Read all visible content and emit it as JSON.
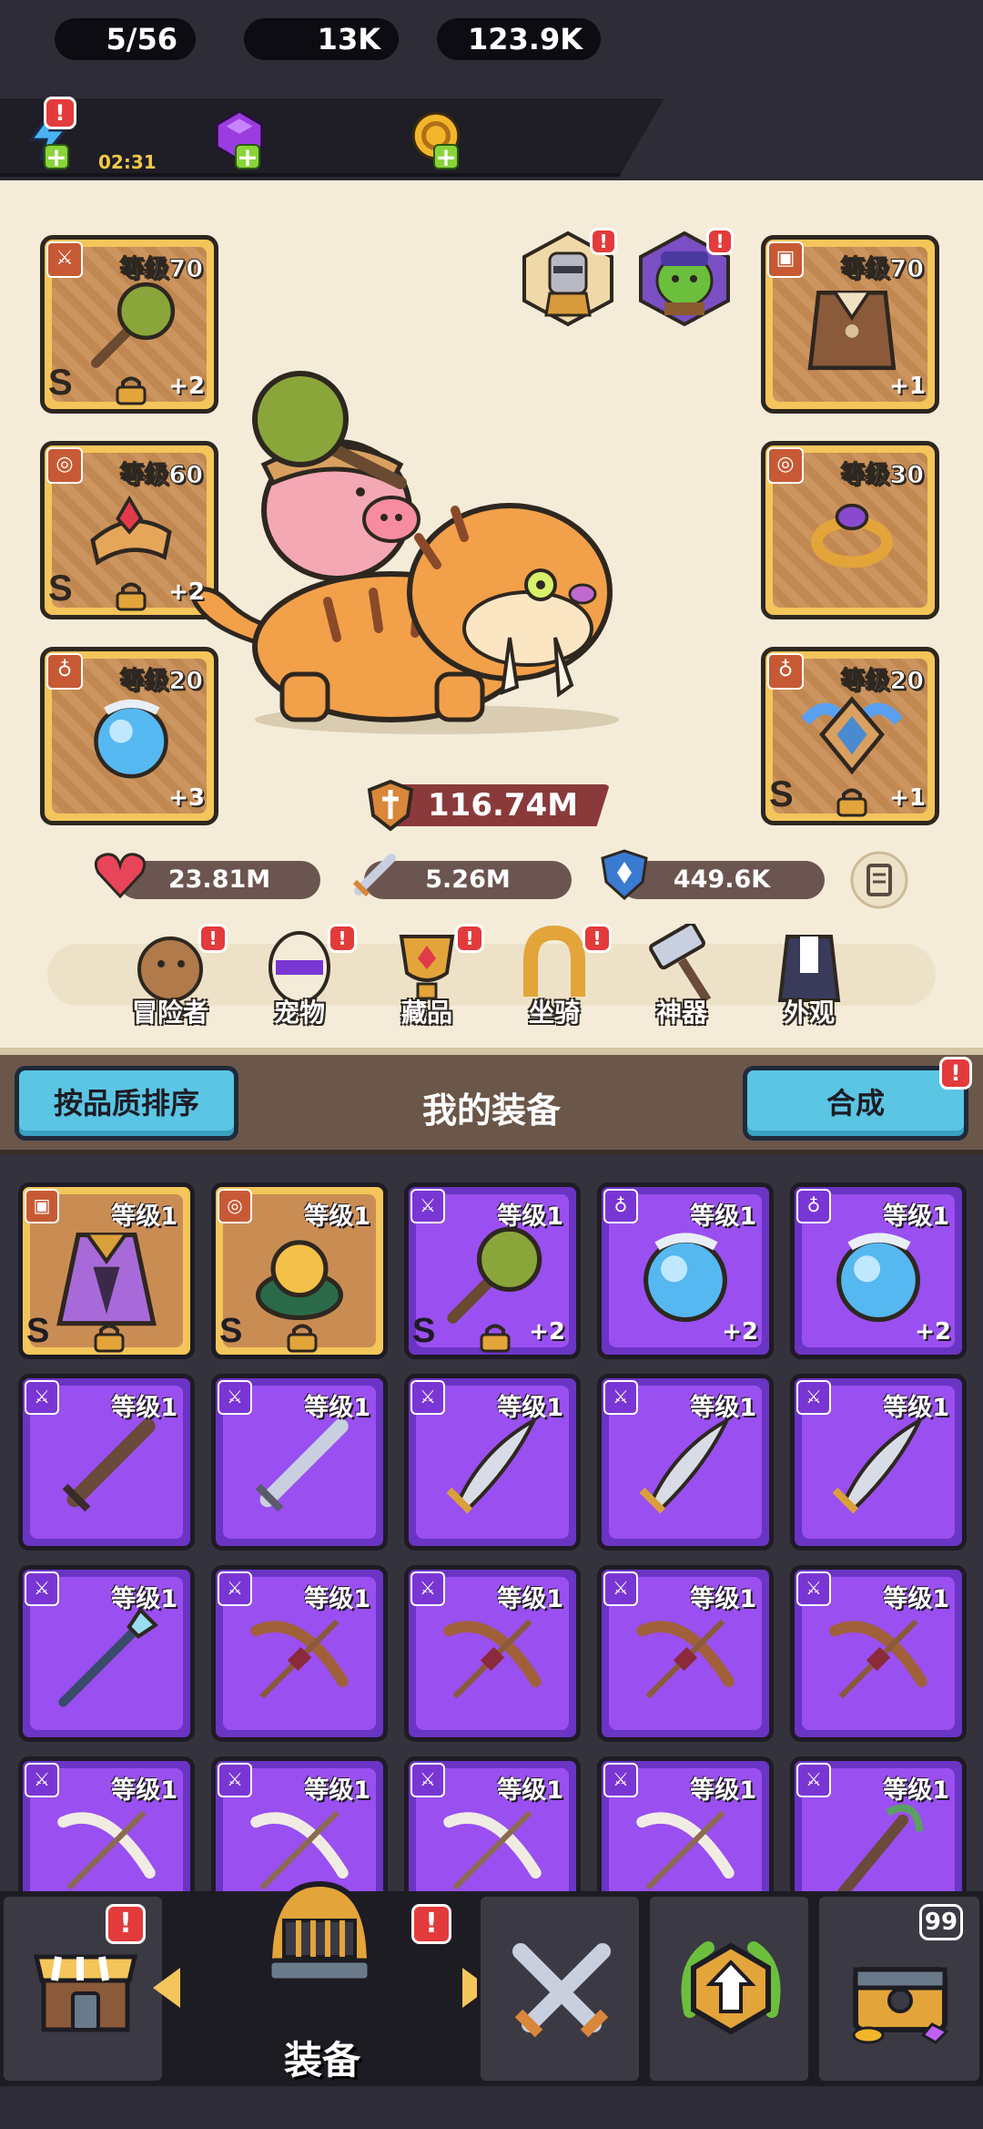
{
  "resources": {
    "energy": "5/56",
    "energy_timer": "02:31",
    "gems": "13K",
    "gold": "123.9K",
    "energy_alert": "!"
  },
  "hero": {
    "slots_left": [
      {
        "level": "等级70",
        "grade": "S",
        "plus": "+2",
        "type_icon": "sword-icon",
        "art": "mace"
      },
      {
        "level": "等级60",
        "grade": "S",
        "plus": "+2",
        "type_icon": "ring-icon",
        "art": "bracer"
      },
      {
        "level": "等级20",
        "grade": "",
        "plus": "+3",
        "type_icon": "necklace-icon",
        "art": "orb"
      }
    ],
    "slots_right": [
      {
        "level": "等级70",
        "grade": "",
        "plus": "+1",
        "type_icon": "armor-icon",
        "art": "armor"
      },
      {
        "level": "等级30",
        "grade": "",
        "plus": "",
        "type_icon": "ring-icon",
        "art": "ring"
      },
      {
        "level": "等级20",
        "grade": "S",
        "plus": "+1",
        "type_icon": "necklace-icon",
        "art": "amulet"
      }
    ],
    "power": "116.74M",
    "stats": {
      "hp": "23.81M",
      "attack": "5.26M",
      "defense": "449.6K"
    },
    "alert": "!"
  },
  "tabs": [
    {
      "label": "冒险者",
      "icon": "capybara-icon",
      "alert": "!"
    },
    {
      "label": "宠物",
      "icon": "egg-icon",
      "alert": "!"
    },
    {
      "label": "藏品",
      "icon": "trophy-icon",
      "alert": "!"
    },
    {
      "label": "坐骑",
      "icon": "horseshoe-icon",
      "alert": "!"
    },
    {
      "label": "神器",
      "icon": "hammer-icon",
      "alert": ""
    },
    {
      "label": "外观",
      "icon": "outfit-icon",
      "alert": ""
    }
  ],
  "equipment": {
    "sort_button": "按品质排序",
    "title": "我的装备",
    "merge_button": "合成",
    "merge_alert": "!",
    "items": [
      {
        "level": "等级1",
        "rarity": "gold",
        "grade": "S",
        "plus": "",
        "lock": true,
        "art": "cape",
        "type_icon": "armor-icon"
      },
      {
        "level": "等级1",
        "rarity": "gold",
        "grade": "S",
        "plus": "",
        "lock": true,
        "art": "gauntlet",
        "type_icon": "ring-icon"
      },
      {
        "level": "等级1",
        "rarity": "purple",
        "grade": "S",
        "plus": "+2",
        "lock": true,
        "art": "mace",
        "type_icon": "sword-icon"
      },
      {
        "level": "等级1",
        "rarity": "purple",
        "grade": "",
        "plus": "+2",
        "lock": false,
        "art": "orb",
        "type_icon": "necklace-icon"
      },
      {
        "level": "等级1",
        "rarity": "purple",
        "grade": "",
        "plus": "+2",
        "lock": false,
        "art": "orb",
        "type_icon": "necklace-icon"
      },
      {
        "level": "等级1",
        "rarity": "purple",
        "grade": "",
        "plus": "",
        "lock": false,
        "art": "wood-sword",
        "type_icon": "sword-icon"
      },
      {
        "level": "等级1",
        "rarity": "purple",
        "grade": "",
        "plus": "",
        "lock": false,
        "art": "steel-sword",
        "type_icon": "sword-icon"
      },
      {
        "level": "等级1",
        "rarity": "purple",
        "grade": "",
        "plus": "",
        "lock": false,
        "art": "scimitar",
        "type_icon": "sword-icon"
      },
      {
        "level": "等级1",
        "rarity": "purple",
        "grade": "",
        "plus": "",
        "lock": false,
        "art": "scimitar",
        "type_icon": "sword-icon"
      },
      {
        "level": "等级1",
        "rarity": "purple",
        "grade": "",
        "plus": "",
        "lock": false,
        "art": "scimitar",
        "type_icon": "sword-icon"
      },
      {
        "level": "等级1",
        "rarity": "purple",
        "grade": "",
        "plus": "",
        "lock": false,
        "art": "spear",
        "type_icon": "sword-icon"
      },
      {
        "level": "等级1",
        "rarity": "purple",
        "grade": "",
        "plus": "",
        "lock": false,
        "art": "bow",
        "type_icon": "sword-icon"
      },
      {
        "level": "等级1",
        "rarity": "purple",
        "grade": "",
        "plus": "",
        "lock": false,
        "art": "bow",
        "type_icon": "sword-icon"
      },
      {
        "level": "等级1",
        "rarity": "purple",
        "grade": "",
        "plus": "",
        "lock": false,
        "art": "bow",
        "type_icon": "sword-icon"
      },
      {
        "level": "等级1",
        "rarity": "purple",
        "grade": "",
        "plus": "",
        "lock": false,
        "art": "bow",
        "type_icon": "sword-icon"
      },
      {
        "level": "等级1",
        "rarity": "purple",
        "grade": "",
        "plus": "",
        "lock": false,
        "art": "bone-bow",
        "type_icon": "sword-icon"
      },
      {
        "level": "等级1",
        "rarity": "purple",
        "grade": "",
        "plus": "",
        "lock": false,
        "art": "bone-bow",
        "type_icon": "sword-icon"
      },
      {
        "level": "等级1",
        "rarity": "purple",
        "grade": "",
        "plus": "",
        "lock": false,
        "art": "bone-bow",
        "type_icon": "sword-icon"
      },
      {
        "level": "等级1",
        "rarity": "purple",
        "grade": "",
        "plus": "",
        "lock": false,
        "art": "bone-bow",
        "type_icon": "sword-icon"
      },
      {
        "level": "等级1",
        "rarity": "purple",
        "grade": "",
        "plus": "",
        "lock": false,
        "art": "staff",
        "type_icon": "sword-icon"
      }
    ]
  },
  "nav": {
    "shop_alert": "!",
    "equip_label": "装备",
    "equip_alert": "!",
    "chest_count": "99"
  },
  "colors": {
    "gold_frame": "#f3c55b",
    "purple_frame": "#6a34c4",
    "accent_blue": "#5bc5e4",
    "alert_red": "#e33b3b"
  }
}
